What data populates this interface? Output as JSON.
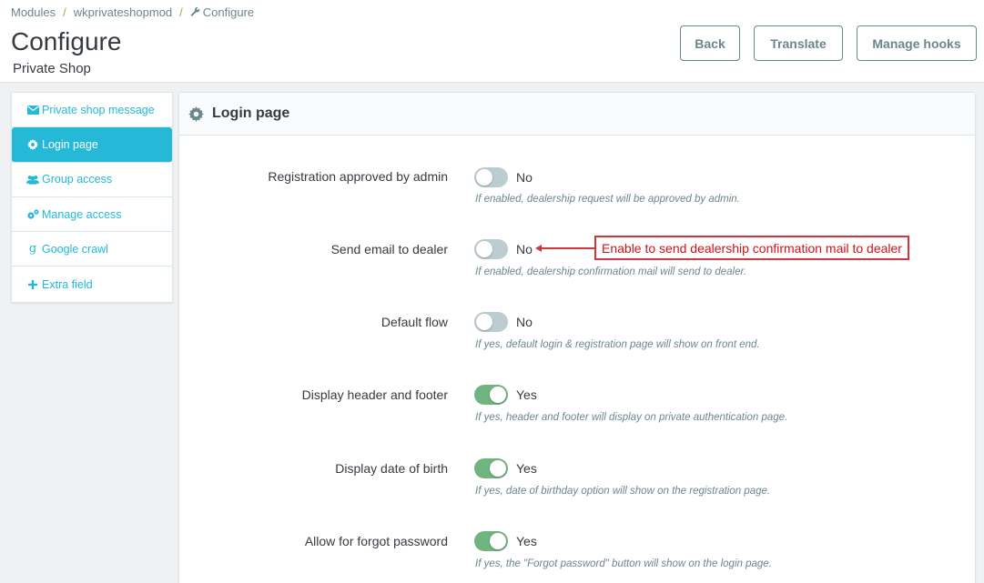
{
  "breadcrumb": {
    "items": [
      "Modules",
      "wkprivateshopmod",
      "Configure"
    ],
    "sep": "/"
  },
  "page": {
    "title": "Configure",
    "subtitle": "Private Shop"
  },
  "toolbar": {
    "back_label": "Back",
    "translate_label": "Translate",
    "hooks_label": "Manage hooks"
  },
  "sidebar": {
    "items": [
      {
        "label": "Private shop message",
        "icon": "envelope-icon",
        "active": false
      },
      {
        "label": "Login page",
        "icon": "gear-icon",
        "active": true
      },
      {
        "label": "Group access",
        "icon": "users-icon",
        "active": false
      },
      {
        "label": "Manage access",
        "icon": "gears-icon",
        "active": false
      },
      {
        "label": "Google crawl",
        "icon": "google-icon",
        "active": false
      },
      {
        "label": "Extra field",
        "icon": "plus-icon",
        "active": false
      }
    ]
  },
  "panel": {
    "title": "Login page",
    "settings": [
      {
        "label": "Registration approved by admin",
        "state": "No",
        "enabled": false,
        "help": "If enabled, dealership request will be approved by admin."
      },
      {
        "label": "Send email to dealer",
        "state": "No",
        "enabled": false,
        "help": "If enabled, dealership confirmation mail will send to dealer."
      },
      {
        "label": "Default flow",
        "state": "No",
        "enabled": false,
        "help": "If yes, default login & registration page will show on front end."
      },
      {
        "label": "Display header and footer",
        "state": "Yes",
        "enabled": true,
        "help": "If yes, header and footer will display on private authentication page."
      },
      {
        "label": "Display date of birth",
        "state": "Yes",
        "enabled": true,
        "help": "If yes, date of birthday option will show on the registration page."
      },
      {
        "label": "Allow for forgot password",
        "state": "Yes",
        "enabled": true,
        "help": "If yes, the \"Forgot password\" button will show on the login page."
      }
    ]
  },
  "annotation": {
    "text": "Enable to send dealership confirmation mail to dealer",
    "color": "#d0363b"
  },
  "colors": {
    "accent": "#25b9d7",
    "switch_on": "#70b580",
    "switch_off": "#bbcdd2"
  }
}
